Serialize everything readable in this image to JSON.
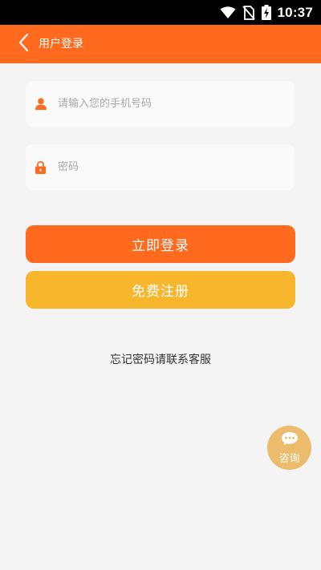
{
  "status_bar": {
    "time": "10:37",
    "icons": [
      "wifi-icon",
      "no-sim-icon",
      "battery-charging-icon"
    ]
  },
  "header": {
    "title": "用户登录",
    "back_icon": "chevron-left-icon",
    "background": "#ff6a1f"
  },
  "form": {
    "phone": {
      "placeholder": "请输入您的手机号码",
      "value": "",
      "icon": "user-icon"
    },
    "password": {
      "placeholder": "密码",
      "value": "",
      "icon": "lock-icon"
    }
  },
  "buttons": {
    "login": {
      "label": "立即登录",
      "color": "#ff6a1f"
    },
    "register": {
      "label": "免费注册",
      "color": "#f8b62d"
    }
  },
  "forgot_text": "忘记密码请联系客服",
  "consult": {
    "label": "咨询",
    "icon": "chat-bubble-icon",
    "color": "#ecbc6c"
  }
}
